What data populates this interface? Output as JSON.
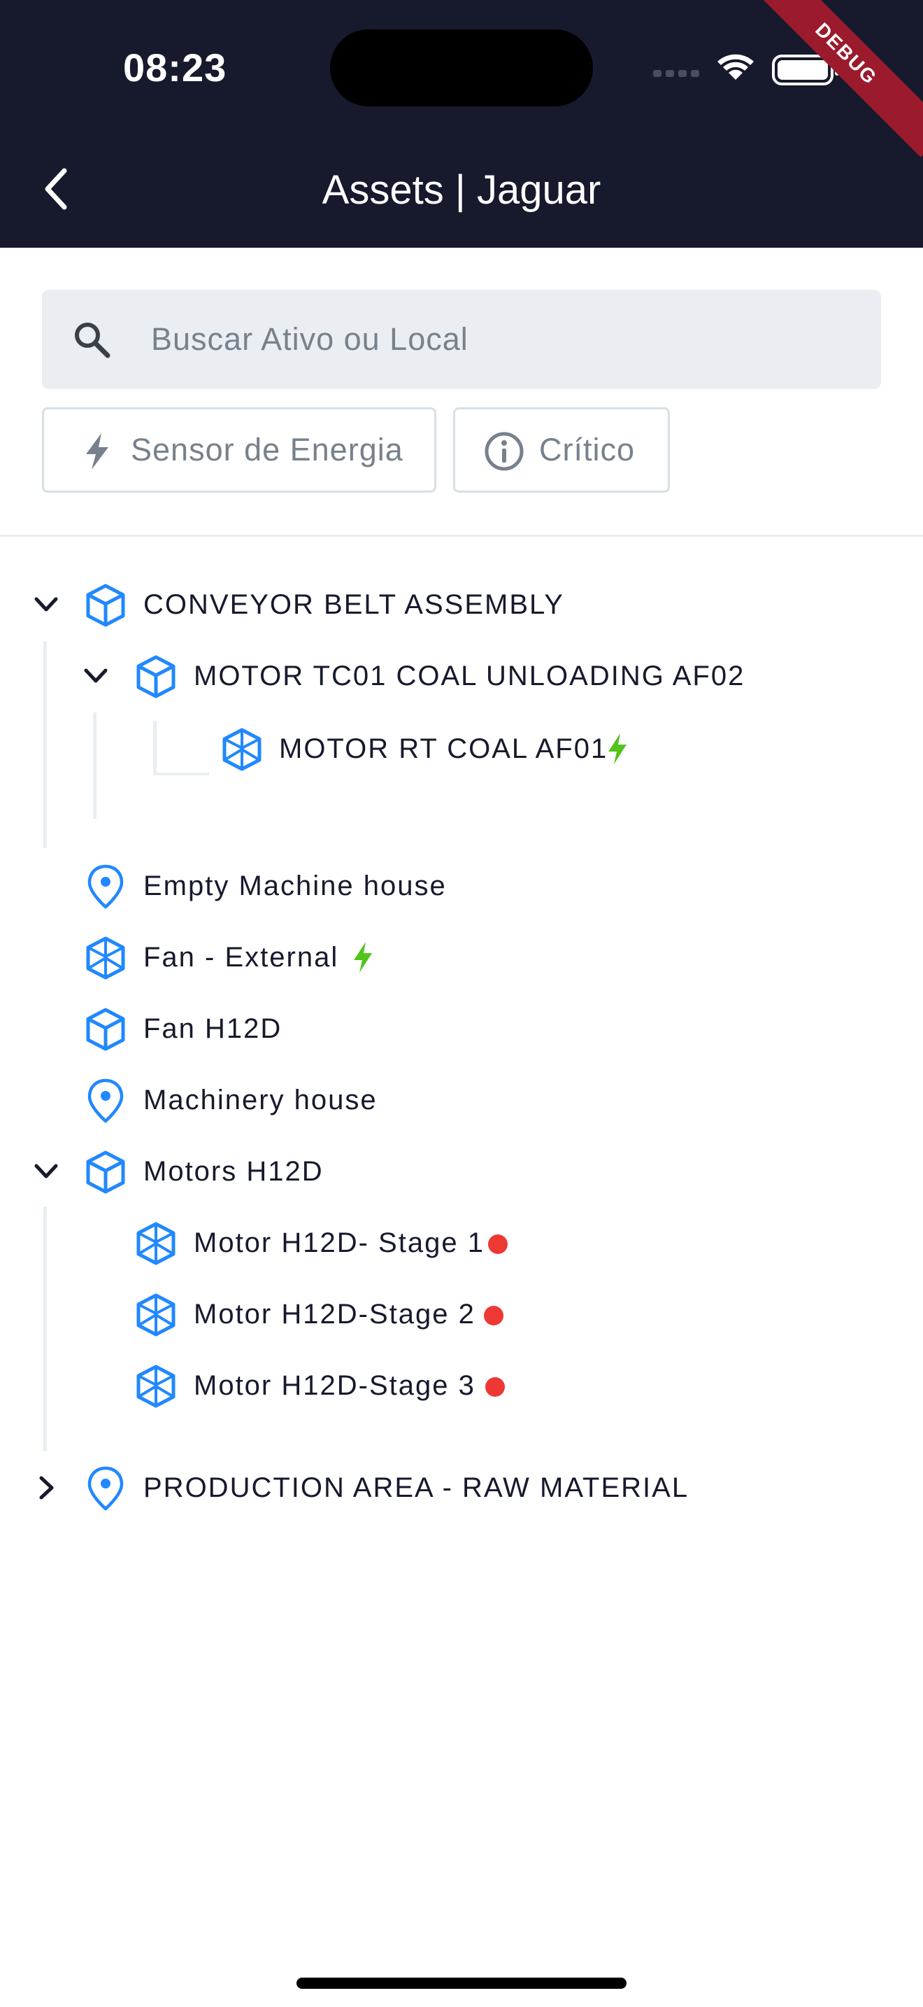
{
  "status": {
    "time": "08:23",
    "debug_label": "DEBUG"
  },
  "header": {
    "title": "Assets | Jaguar"
  },
  "search": {
    "placeholder": "Buscar Ativo ou Local",
    "value": ""
  },
  "filters": {
    "energy_label": "Sensor de Energia",
    "critical_label": "Crítico"
  },
  "tree": {
    "conveyor": "CONVEYOR BELT ASSEMBLY",
    "motor_tc01": "MOTOR TC01 COAL UNLOADING AF02",
    "motor_rt": "MOTOR RT COAL AF01",
    "empty_machine": "Empty Machine house",
    "fan_external": "Fan - External",
    "fan_h12d": "Fan H12D",
    "machinery": "Machinery house",
    "motors_h12d": "Motors H12D",
    "stage1": "Motor H12D- Stage 1",
    "stage2": "Motor H12D-Stage 2",
    "stage3": "Motor H12D-Stage 3",
    "production": "PRODUCTION AREA - RAW MATERIAL"
  },
  "colors": {
    "appbar": "#17192d",
    "accent_icon": "#2188ff",
    "energy": "#52c41a",
    "critical": "#ed3833"
  },
  "icons": {
    "asset": "cube-icon",
    "component": "component-icon",
    "location": "location-pin-icon",
    "energy": "bolt-icon",
    "critical": "critical-dot",
    "search": "search-icon"
  }
}
